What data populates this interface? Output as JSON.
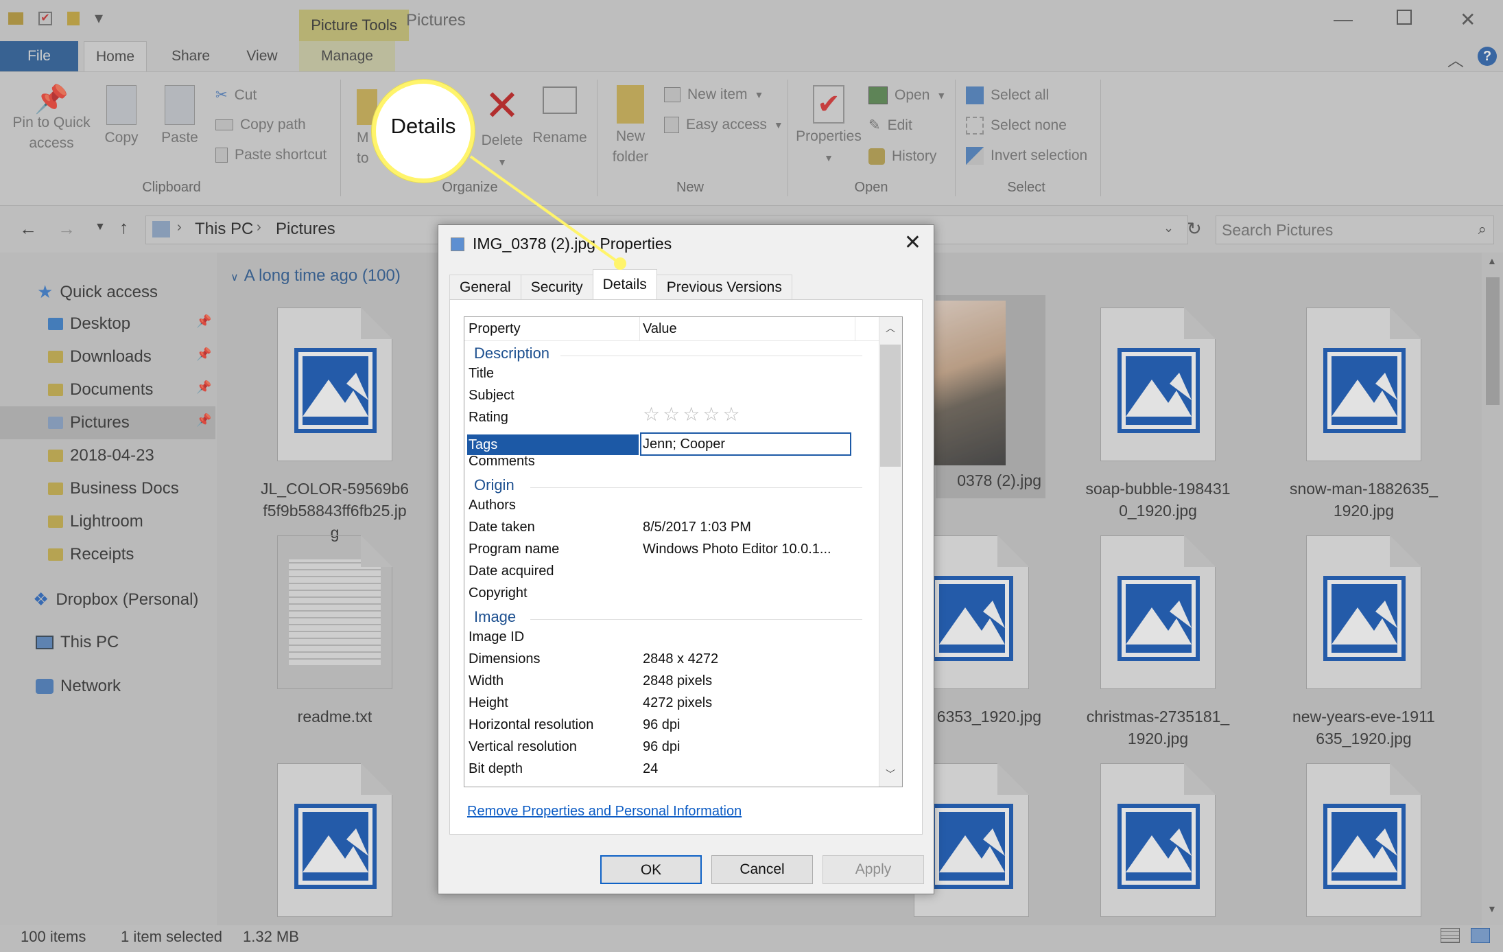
{
  "window": {
    "contextual_tab": "Picture Tools",
    "title": "Pictures"
  },
  "ribbon": {
    "tabs": [
      "File",
      "Home",
      "Share",
      "View",
      "Manage"
    ],
    "clipboard": {
      "pin": "Pin to Quick access",
      "copy": "Copy",
      "paste": "Paste",
      "cut": "Cut",
      "copy_path": "Copy path",
      "paste_shortcut": "Paste shortcut",
      "label": "Clipboard"
    },
    "organize": {
      "move_to_1": "M",
      "move_to_2": "to",
      "delete": "Delete",
      "rename": "Rename",
      "label": "Organize"
    },
    "new": {
      "new_folder_1": "New",
      "new_folder_2": "folder",
      "new_item": "New item",
      "easy_access": "Easy access",
      "label": "New"
    },
    "open": {
      "properties": "Properties",
      "open": "Open",
      "edit": "Edit",
      "history": "History",
      "label": "Open"
    },
    "select": {
      "select_all": "Select all",
      "select_none": "Select none",
      "invert": "Invert selection",
      "label": "Select"
    }
  },
  "address": {
    "crumbs": [
      "This PC",
      "Pictures"
    ],
    "search_placeholder": "Search Pictures"
  },
  "nav": {
    "quick_access": "Quick access",
    "items": [
      "Desktop",
      "Downloads",
      "Documents",
      "Pictures",
      "2018-04-23",
      "Business Docs",
      "Lightroom",
      "Receipts"
    ],
    "dropbox": "Dropbox (Personal)",
    "this_pc": "This PC",
    "network": "Network"
  },
  "content": {
    "group_header": "A long time ago (100)",
    "files": [
      "JL_COLOR-59569b6f5f9b58843ff6fb25.jpg",
      "readme.txt",
      "0378 (2).jpg",
      "soap-bubble-1984310_1920.jpg",
      "snow-man-1882635_1920.jpg",
      "6353_1920.jpg",
      "christmas-2735181_1920.jpg",
      "new-years-eve-1911635_1920.jpg"
    ]
  },
  "status": {
    "items": "100 items",
    "selected": "1 item selected",
    "size": "1.32 MB"
  },
  "dialog": {
    "title": "IMG_0378 (2).jpg Properties",
    "tabs": [
      "General",
      "Security",
      "Details",
      "Previous Versions"
    ],
    "active_tab": "Details",
    "col_property": "Property",
    "col_value": "Value",
    "sections": {
      "description": "Description",
      "origin": "Origin",
      "image": "Image"
    },
    "rows": {
      "title": "Title",
      "subject": "Subject",
      "rating": "Rating",
      "tags": "Tags",
      "tags_value": "Jenn; Cooper",
      "comments": "Comments",
      "authors": "Authors",
      "date_taken": "Date taken",
      "date_taken_value": "8/5/2017 1:03 PM",
      "program_name": "Program name",
      "program_name_value": "Windows Photo Editor 10.0.1...",
      "date_acquired": "Date acquired",
      "copyright": "Copyright",
      "image_id": "Image ID",
      "dimensions": "Dimensions",
      "dimensions_value": "2848 x 4272",
      "width": "Width",
      "width_value": "2848 pixels",
      "height": "Height",
      "height_value": "4272 pixels",
      "hres": "Horizontal resolution",
      "hres_value": "96 dpi",
      "vres": "Vertical resolution",
      "vres_value": "96 dpi",
      "bitdepth": "Bit depth",
      "bitdepth_value": "24"
    },
    "rating_stars": 0,
    "link": "Remove Properties and Personal Information",
    "ok": "OK",
    "cancel": "Cancel",
    "apply": "Apply"
  },
  "callout": {
    "label": "Details",
    "color": "#fff46b"
  }
}
